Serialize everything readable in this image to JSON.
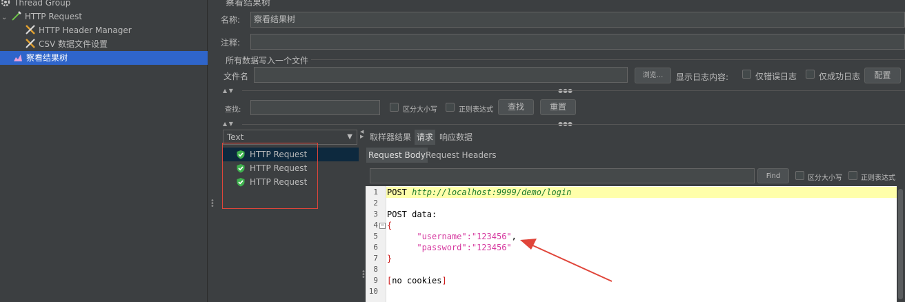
{
  "tree": {
    "items": [
      {
        "label": "Thread Group",
        "icon": "gear-icon"
      },
      {
        "label": "HTTP Request",
        "icon": "pipette-icon"
      },
      {
        "label": "HTTP Header Manager",
        "icon": "wrench-icon"
      },
      {
        "label": "CSV 数据文件设置",
        "icon": "wrench-icon"
      },
      {
        "label": "察看结果树",
        "icon": "chart-icon"
      }
    ]
  },
  "panel": {
    "title": "察看结果树",
    "name_label": "名称:",
    "name_value": "察看结果树",
    "comment_label": "注释:",
    "comment_value": "",
    "file_section_title": "所有数据写入一个文件",
    "filename_label": "文件名",
    "filename_value": "",
    "browse_button": "浏览...",
    "log_content_label": "显示日志内容:",
    "errors_only_label": "仅错误日志",
    "success_only_label": "仅成功日志",
    "config_button": "配置",
    "search_label": "查找:",
    "search_value": "",
    "case_sensitive_label": "区分大小写",
    "regex_label": "正则表达式",
    "find_button": "查找",
    "reset_button": "重置"
  },
  "results": {
    "renderer": "Text",
    "items": [
      "HTTP Request",
      "HTTP Request",
      "HTTP Request"
    ]
  },
  "tabs": {
    "items": [
      "取样器结果",
      "请求",
      "响应数据"
    ],
    "active": "请求"
  },
  "subtabs": {
    "items": [
      "Request Body",
      "Request Headers"
    ],
    "active": "Request Body"
  },
  "request_search": {
    "value": "",
    "find_button": "Find",
    "case_sensitive_label": "区分大小写",
    "regex_label": "正则表达式"
  },
  "editor": {
    "line_numbers": [
      "1",
      "2",
      "3",
      "4",
      "5",
      "6",
      "7",
      "8",
      "9",
      "10"
    ],
    "line1_method": "POST ",
    "line1_url": "http://localhost:9999/demo/login",
    "line3": "POST data:",
    "line4": "{",
    "line5_key": "\"username\"",
    "line5_colon": ":",
    "line5_value": "\"123456\"",
    "line5_comma": ",",
    "line6_key": "\"password\"",
    "line6_colon": ":",
    "line6_value": "\"123456\"",
    "line7": "}",
    "line9_open": "[",
    "line9_text": "no cookies",
    "line9_close": "]"
  },
  "colors": {
    "background": "#3c3f41",
    "selection": "#2f65ca",
    "annotation_red": "#e0453a",
    "string_pink": "#d63aa0",
    "url_green": "#1d7c2e",
    "highlight_line": "#ffffaa"
  }
}
